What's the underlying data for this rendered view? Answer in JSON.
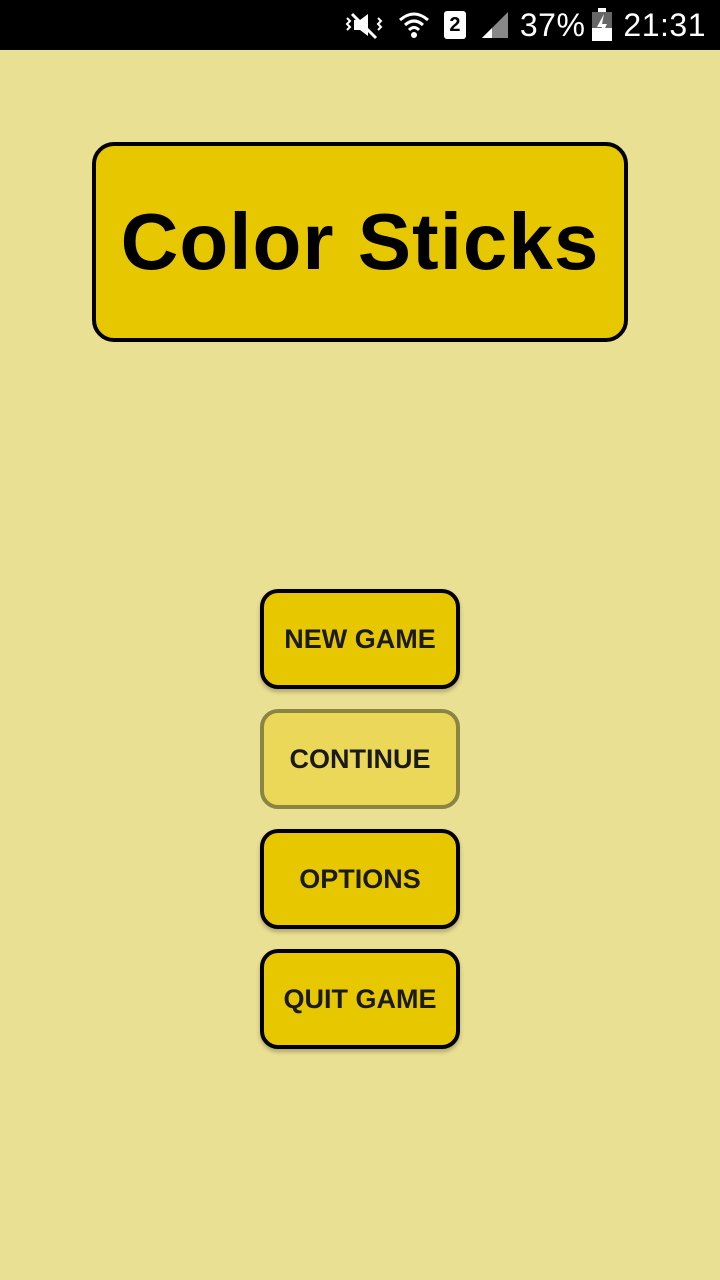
{
  "status_bar": {
    "battery": "37%",
    "time": "21:31",
    "sim_slot": "2",
    "icons": [
      "vibrate-mute-icon",
      "wifi-icon",
      "sim-2-icon",
      "signal-icon",
      "battery-charging-icon"
    ]
  },
  "title": "Color Sticks",
  "menu": {
    "new_game": "NEW GAME",
    "continue": "CONTINUE",
    "options": "OPTIONS",
    "quit_game": "QUIT GAME"
  },
  "colors": {
    "background": "#EAE093",
    "button": "#E7C800",
    "button_disabled": "#EBD858",
    "border": "#000000"
  }
}
